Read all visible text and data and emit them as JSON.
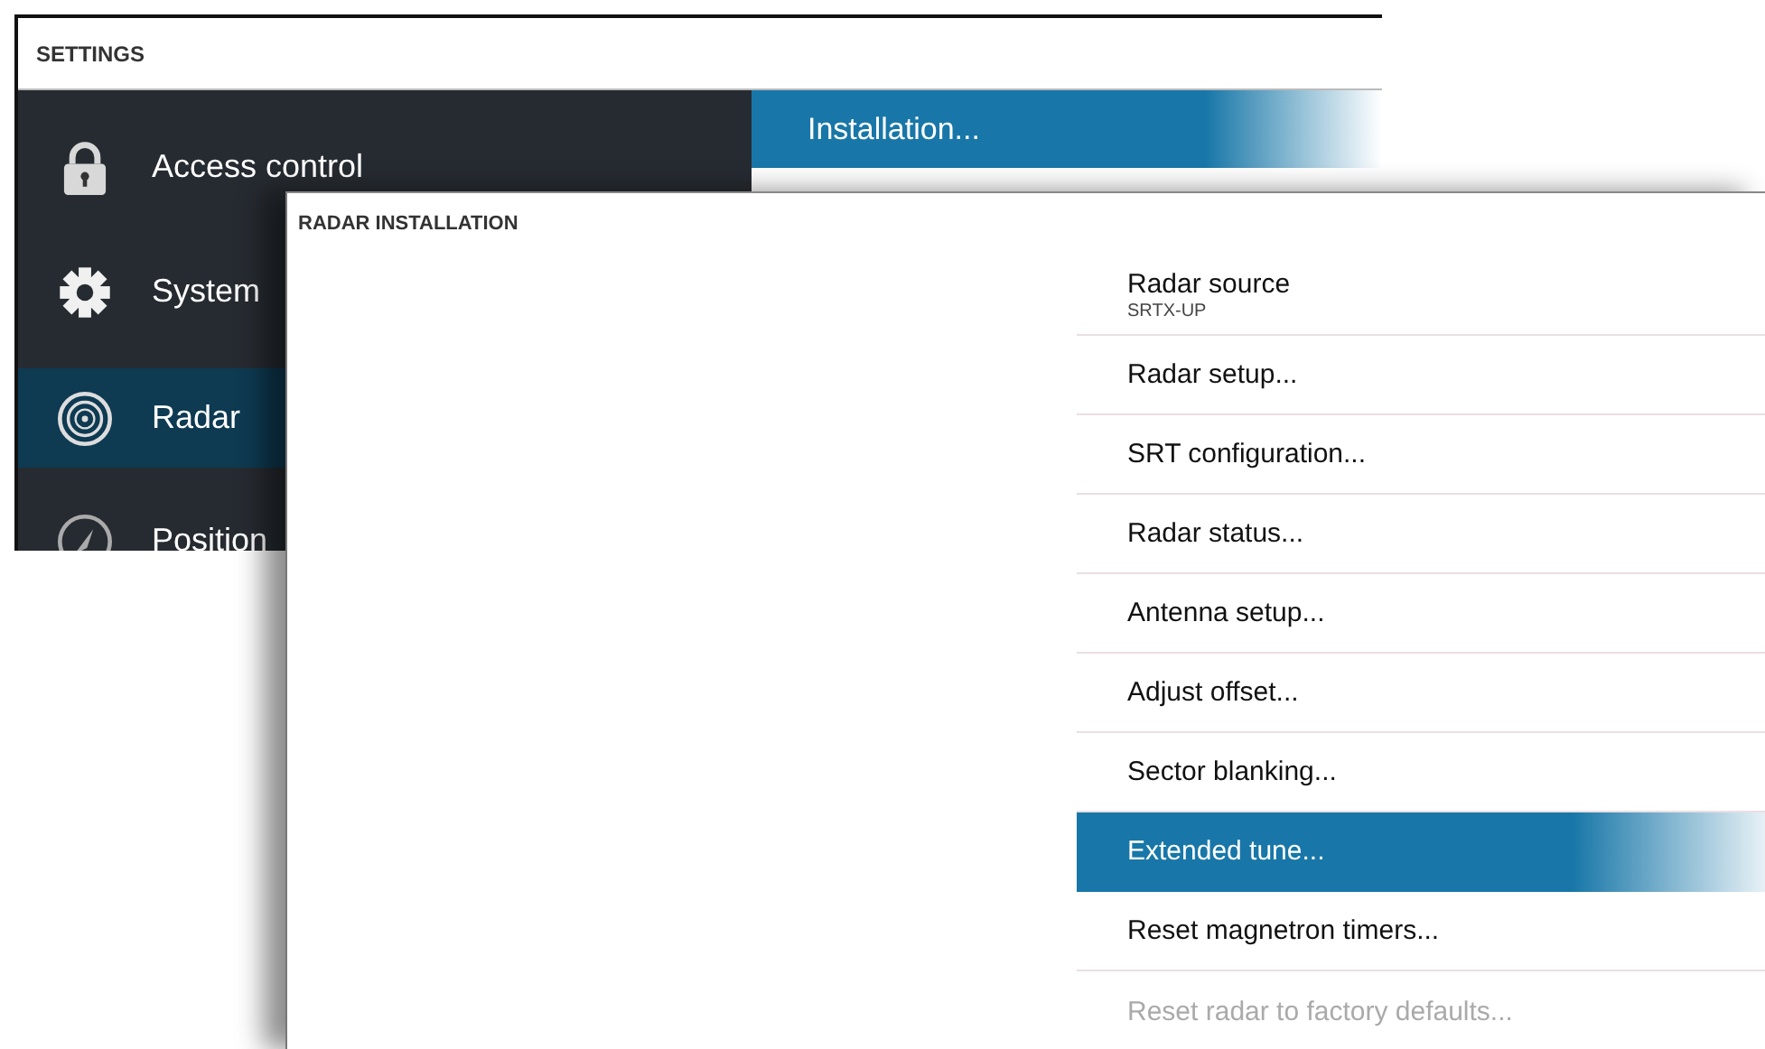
{
  "settings_window": {
    "title": "SETTINGS",
    "sidebar": {
      "items": [
        {
          "label": "Access control",
          "selected": false
        },
        {
          "label": "System",
          "selected": false
        },
        {
          "label": "Radar",
          "selected": true
        },
        {
          "label": "Position",
          "selected": false
        }
      ]
    },
    "submenu": {
      "items": [
        {
          "label": "Installation...",
          "selected": true
        }
      ]
    }
  },
  "dialog": {
    "title": "RADAR INSTALLATION",
    "items": [
      {
        "label": "Radar source",
        "value": "SRTX-UP",
        "selected": false,
        "disabled": false
      },
      {
        "label": "Radar setup...",
        "selected": false,
        "disabled": false
      },
      {
        "label": "SRT configuration...",
        "selected": false,
        "disabled": false
      },
      {
        "label": "Radar status...",
        "selected": false,
        "disabled": false
      },
      {
        "label": "Antenna setup...",
        "selected": false,
        "disabled": false
      },
      {
        "label": "Adjust offset...",
        "selected": false,
        "disabled": false
      },
      {
        "label": "Sector blanking...",
        "selected": false,
        "disabled": false
      },
      {
        "label": "Extended tune...",
        "selected": true,
        "disabled": false
      },
      {
        "label": "Reset magnetron timers...",
        "selected": false,
        "disabled": false
      },
      {
        "label": "Reset radar to factory defaults...",
        "selected": false,
        "disabled": true
      }
    ]
  }
}
